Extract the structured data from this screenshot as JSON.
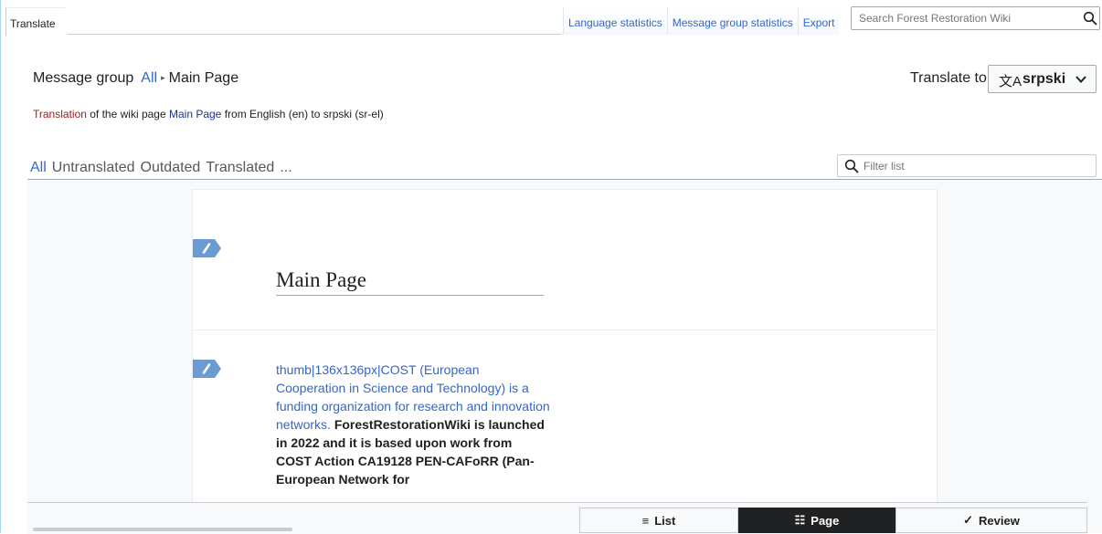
{
  "topbar": {
    "tab_label": "Translate",
    "links": [
      "Language statistics",
      "Message group statistics",
      "Export"
    ],
    "search_placeholder": "Search Forest Restoration Wiki",
    "search_icon": "search-icon"
  },
  "header": {
    "message_group_label": "Message group",
    "group_all": "All",
    "separator": "▸",
    "group_current": "Main Page",
    "translate_to_label": "Translate to",
    "language_icon": "translate-icon",
    "language": "srpski",
    "description": {
      "translation_link": "Translation",
      "text1": " of the wiki page ",
      "page_link": "Main Page",
      "text2": " from English (en) to srpski (sr-el)"
    }
  },
  "filters": {
    "tabs": [
      "All",
      "Untranslated",
      "Outdated",
      "Translated",
      "..."
    ],
    "active": "All",
    "filter_placeholder": "Filter list"
  },
  "content": {
    "units": [
      {
        "title": "Main Page"
      },
      {
        "link_text": "thumb|136x136px|COST (European Cooperation in Science and Technology) is a funding organization for research and innovation networks.",
        "bold_text": "ForestRestorationWiki is launched in 2022 and it is based upon work from COST Action CA19128 PEN-CAFoRR (Pan-European Network for"
      }
    ]
  },
  "modes": {
    "list": "List",
    "page": "Page",
    "review": "Review",
    "list_icon": "≡",
    "page_icon": "☷",
    "review_icon": "✓",
    "active": "page"
  },
  "colors": {
    "link": "#3366cc",
    "accent_dark": "#202122",
    "tag": "#6b9bd3",
    "red_link": "#a01f1f"
  }
}
